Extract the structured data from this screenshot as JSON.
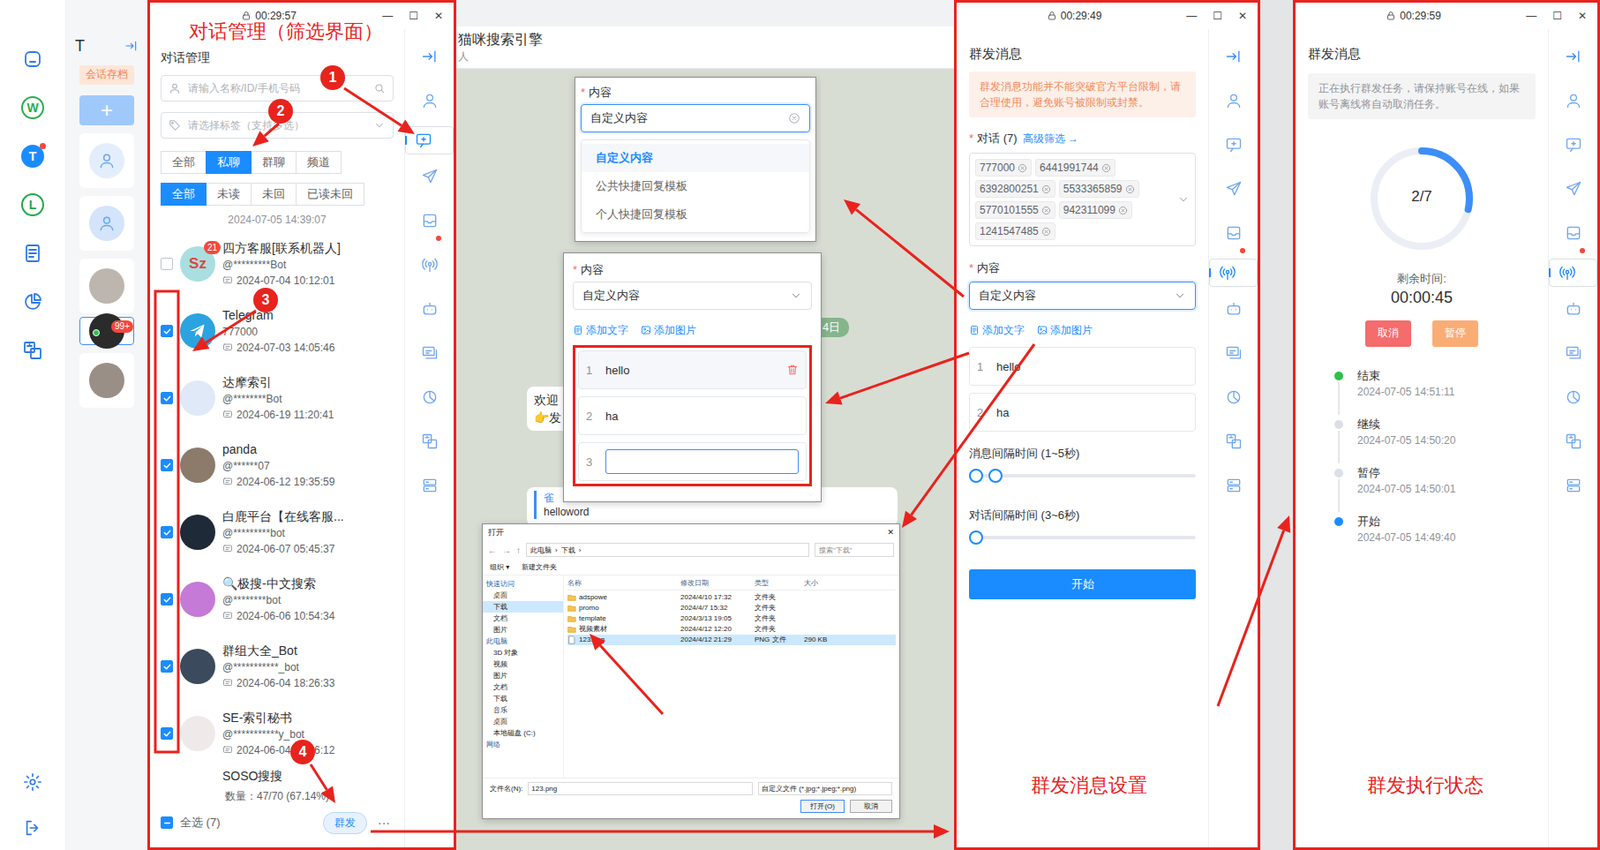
{
  "app_nav": {
    "items": [
      {
        "kind": "icon",
        "selected": false,
        "dot": false
      },
      {
        "kind": "letter",
        "text": "W",
        "color": "#2bae4f",
        "selected": false,
        "dot": false
      },
      {
        "kind": "letter",
        "text": "T",
        "color": "#1a8cff",
        "selected": true,
        "dot": true
      },
      {
        "kind": "letter",
        "text": "L",
        "color": "#22a947",
        "selected": false,
        "dot": false
      },
      {
        "kind": "icon",
        "selected": false,
        "dot": false
      },
      {
        "kind": "icon",
        "selected": false,
        "dot": false
      },
      {
        "kind": "icon",
        "selected": false,
        "dot": false
      }
    ]
  },
  "accounts": {
    "title": "T",
    "tag": "会话存档",
    "add_button": "+",
    "avatars": [
      {
        "kind": "default",
        "color": "#e3eefc",
        "selected": false,
        "badge": "",
        "online": false
      },
      {
        "kind": "default",
        "color": "#d3e4fb",
        "selected": false,
        "badge": "",
        "online": false
      },
      {
        "kind": "photo",
        "color": "#bdb6ae",
        "selected": false,
        "badge": "",
        "online": false
      },
      {
        "kind": "photo",
        "color": "#2b2b2b",
        "selected": true,
        "badge": "99+",
        "online": true
      },
      {
        "kind": "photo",
        "color": "#9a8f86",
        "selected": false,
        "badge": "",
        "online": false
      }
    ]
  },
  "conversation_panel": {
    "titlebar": {
      "time": "00:29:57",
      "controls": [
        "—",
        "☐",
        "✕"
      ]
    },
    "title": "对话管理",
    "search": {
      "placeholder": "请输入名称/ID/手机号码"
    },
    "tag_select": {
      "placeholder": "请选择标签（支持多选）"
    },
    "type_tabs": [
      {
        "label": "全部",
        "selected": false
      },
      {
        "label": "私聊",
        "selected": true
      },
      {
        "label": "群聊",
        "selected": false
      },
      {
        "label": "频道",
        "selected": false
      }
    ],
    "read_filters": [
      {
        "label": "全部",
        "selected": true
      },
      {
        "label": "未读",
        "selected": false
      },
      {
        "label": "未回",
        "selected": false
      },
      {
        "label": "已读未回",
        "selected": false
      }
    ],
    "sync_time": "2024-07-05 14:39:07",
    "rows": [
      {
        "kind": "full",
        "name": "四方客服[联系机器人]",
        "handle": "@*********Bot",
        "time": "2024-07-04 10:12:01",
        "checked": false,
        "badge": "21",
        "avatar": {
          "kind": "text",
          "text": "Sz",
          "color": "#a9dfe0"
        }
      },
      {
        "kind": "full",
        "name": "Telegram",
        "handle": "777000",
        "time": "2024-07-03 14:05:46",
        "checked": true,
        "badge": "",
        "avatar": {
          "kind": "logo",
          "color": "#2aa3e0"
        }
      },
      {
        "kind": "full",
        "name": "达摩索引",
        "handle": "@********Bot",
        "time": "2024-06-19 11:20:41",
        "checked": true,
        "badge": "",
        "avatar": {
          "kind": "photo",
          "color": "#dfe9f7"
        }
      },
      {
        "kind": "full",
        "name": "panda",
        "handle": "@******07",
        "time": "2024-06-12 19:35:59",
        "checked": true,
        "badge": "",
        "avatar": {
          "kind": "photo",
          "color": "#8c7a6a"
        }
      },
      {
        "kind": "full",
        "name": "白鹿平台【在线客服...",
        "handle": "@*********bot",
        "time": "2024-06-07 05:45:37",
        "checked": true,
        "badge": "",
        "avatar": {
          "kind": "photo",
          "color": "#1e2a38"
        }
      },
      {
        "kind": "full",
        "name": "🔍极搜-中文搜索",
        "handle": "@********bot",
        "time": "2024-06-06 10:54:34",
        "checked": true,
        "badge": "",
        "avatar": {
          "kind": "photo",
          "color": "#c47ad6"
        }
      },
      {
        "kind": "full",
        "name": "群组大全_Bot",
        "handle": "@***********_bot",
        "time": "2024-06-04 18:26:33",
        "checked": true,
        "badge": "",
        "avatar": {
          "kind": "photo",
          "color": "#3b4a5c"
        }
      },
      {
        "kind": "full",
        "name": "SE-索引秘书",
        "handle": "@***********y_bot",
        "time": "2024-06-04 18:26:12",
        "checked": true,
        "badge": "",
        "avatar": {
          "kind": "photo",
          "color": "#efe9e9"
        }
      },
      {
        "kind": "partial",
        "name": "SOSO搜搜",
        "handle": "",
        "time": "",
        "checked": false,
        "badge": "",
        "avatar": {
          "kind": "photo",
          "color": "#cccccc"
        }
      }
    ],
    "count": "数量：47/70 (67.14%)",
    "select_all": {
      "label": "全选 (7)",
      "checked": false,
      "indeterminate": true
    },
    "broadcast_button": "群发",
    "more": "···",
    "rail": [
      {
        "selected": false,
        "dot": false
      },
      {
        "selected": false,
        "dot": false
      },
      {
        "selected": true,
        "dot": false
      },
      {
        "selected": false,
        "dot": false
      },
      {
        "selected": false,
        "dot": true
      },
      {
        "selected": false,
        "dot": false
      },
      {
        "selected": false,
        "dot": false
      },
      {
        "selected": false,
        "dot": false
      },
      {
        "selected": false,
        "dot": false
      },
      {
        "selected": false,
        "dot": false
      },
      {
        "selected": false,
        "dot": false
      }
    ]
  },
  "chat": {
    "title": "猫咪搜索引擎",
    "subtitle": "人",
    "date_pill": "月4日",
    "bubble": [
      "欢迎",
      "👉发"
    ],
    "card": {
      "sender": "雀",
      "text": "helloword"
    }
  },
  "content_dropdown": {
    "required_mark": "*",
    "label": "内容",
    "value": "自定义内容",
    "options": [
      {
        "label": "自定义内容",
        "selected": true
      },
      {
        "label": "公共快捷回复模板",
        "selected": false
      },
      {
        "label": "个人快捷回复模板",
        "selected": false
      }
    ]
  },
  "content_editor": {
    "required_mark": "*",
    "label": "内容",
    "value": "自定义内容",
    "add_text": "添加文字",
    "add_image": "添加图片",
    "items": [
      {
        "index": "1",
        "text": "hello",
        "hovered": true,
        "focused": false
      },
      {
        "index": "2",
        "text": "ha",
        "hovered": false,
        "focused": false
      },
      {
        "index": "3",
        "text": "",
        "hovered": false,
        "focused": true
      }
    ]
  },
  "file_dialog": {
    "title": "打开",
    "close": "✕",
    "nav_buttons": [
      "←",
      "→",
      "↑"
    ],
    "path": [
      "此电脑",
      "下载"
    ],
    "path_separator": "›",
    "search_placeholder": "搜索\"下载\"",
    "toolbar": [
      "组织 ▾",
      "新建文件夹"
    ],
    "tree": [
      {
        "label": "快速访问",
        "kind": "group",
        "selected": false
      },
      {
        "label": "桌面",
        "kind": "item",
        "selected": false
      },
      {
        "label": "下载",
        "kind": "item",
        "selected": true
      },
      {
        "label": "文档",
        "kind": "item",
        "selected": false
      },
      {
        "label": "图片",
        "kind": "item",
        "selected": false
      },
      {
        "label": "此电脑",
        "kind": "group",
        "selected": false
      },
      {
        "label": "3D 对象",
        "kind": "item",
        "selected": false
      },
      {
        "label": "视频",
        "kind": "item",
        "selected": false
      },
      {
        "label": "图片",
        "kind": "item",
        "selected": false
      },
      {
        "label": "文档",
        "kind": "item",
        "selected": false
      },
      {
        "label": "下载",
        "kind": "item",
        "selected": false
      },
      {
        "label": "音乐",
        "kind": "item",
        "selected": false
      },
      {
        "label": "桌面",
        "kind": "item",
        "selected": false
      },
      {
        "label": "本地磁盘 (C:)",
        "kind": "item",
        "selected": false
      },
      {
        "label": "网络",
        "kind": "group",
        "selected": false
      }
    ],
    "columns": [
      "名称",
      "修改日期",
      "类型",
      "大小"
    ],
    "files": [
      {
        "name": "adspowe",
        "date": "2024/4/10 17:32",
        "type": "文件夹",
        "size": "",
        "kind": "folder",
        "selected": false
      },
      {
        "name": "promo",
        "date": "2024/4/7 15:32",
        "type": "文件夹",
        "size": "",
        "kind": "folder",
        "selected": false
      },
      {
        "name": "template",
        "date": "2024/3/13 19:05",
        "type": "文件夹",
        "size": "",
        "kind": "folder",
        "selected": false
      },
      {
        "name": "视频素材",
        "date": "2024/4/12 12:20",
        "type": "文件夹",
        "size": "",
        "kind": "folder",
        "selected": false
      },
      {
        "name": "123.png",
        "date": "2024/4/12 21:29",
        "type": "PNG 文件",
        "size": "290 KB",
        "kind": "file",
        "selected": true
      }
    ],
    "filename_label": "文件名(N):",
    "filename": "123.png",
    "filter": "自定义文件 (*.jpg;*.jpeg;*.png)",
    "open": "打开(O)",
    "cancel": "取消"
  },
  "broadcast_settings": {
    "titlebar": {
      "time": "00:29:49",
      "controls": [
        "—",
        "☐",
        "✕"
      ]
    },
    "title": "群发消息",
    "warning": "群发消息功能并不能突破官方平台限制，请合理使用，避免账号被限制或封禁。",
    "required_mark": "*",
    "conversations_label": "对话 (7)",
    "advanced_filter": "高级筛选 →",
    "targets": [
      "777000",
      "6441991744",
      "6392800251",
      "5533365859",
      "5770101555",
      "942311099",
      "1241547485"
    ],
    "content": {
      "required_mark": "*",
      "label": "内容",
      "value": "自定义内容",
      "add_text": "添加文字",
      "add_image": "添加图片",
      "items": [
        {
          "index": "1",
          "text": "hello"
        },
        {
          "index": "2",
          "text": "ha"
        }
      ]
    },
    "sliders": [
      {
        "label": "消息间隔时间 (1~5秒)",
        "kind": "range",
        "level_start": 0,
        "level": 0.04
      },
      {
        "label": "对话间隔时间 (3~6秒)",
        "kind": "single",
        "level_start": 0,
        "level": 0
      }
    ],
    "start_button": "开始",
    "rail": [
      {
        "selected": false,
        "dot": false
      },
      {
        "selected": false,
        "dot": false
      },
      {
        "selected": false,
        "dot": false
      },
      {
        "selected": false,
        "dot": false
      },
      {
        "selected": false,
        "dot": true
      },
      {
        "selected": true,
        "dot": false
      },
      {
        "selected": false,
        "dot": false
      },
      {
        "selected": false,
        "dot": false
      },
      {
        "selected": false,
        "dot": false
      },
      {
        "selected": false,
        "dot": false
      },
      {
        "selected": false,
        "dot": false
      }
    ]
  },
  "broadcast_status": {
    "titlebar": {
      "time": "00:29:59",
      "controls": [
        "—",
        "☐",
        "✕"
      ]
    },
    "title": "群发消息",
    "info": "正在执行群发任务，请保持账号在线，如果账号离线将自动取消任务。",
    "progress": {
      "text": "2/7",
      "level": 0.2857
    },
    "remaining_label": "剩余时间:",
    "remaining": "00:00:45",
    "cancel_button": "取消",
    "pause_button": "暂停",
    "timeline": [
      {
        "label": "结束",
        "time": "2024-07-05 14:51:11",
        "color": "#2bc14b"
      },
      {
        "label": "继续",
        "time": "2024-07-05 14:50:20",
        "color": "#dcdfe6"
      },
      {
        "label": "暂停",
        "time": "2024-07-05 14:50:01",
        "color": "#dcdfe6"
      },
      {
        "label": "开始",
        "time": "2024-07-05 14:49:40",
        "color": "#1a8cff"
      }
    ],
    "rail": [
      {
        "selected": false,
        "dot": false
      },
      {
        "selected": false,
        "dot": false
      },
      {
        "selected": false,
        "dot": false
      },
      {
        "selected": false,
        "dot": false
      },
      {
        "selected": false,
        "dot": true
      },
      {
        "selected": true,
        "dot": false
      },
      {
        "selected": false,
        "dot": false
      },
      {
        "selected": false,
        "dot": false
      },
      {
        "selected": false,
        "dot": false
      },
      {
        "selected": false,
        "dot": false
      },
      {
        "selected": false,
        "dot": false
      }
    ]
  },
  "annotations": {
    "labels": [
      "对话管理（筛选界面）",
      "群发消息设置",
      "群发执行状态"
    ],
    "markers": [
      "1",
      "2",
      "3",
      "4"
    ]
  }
}
